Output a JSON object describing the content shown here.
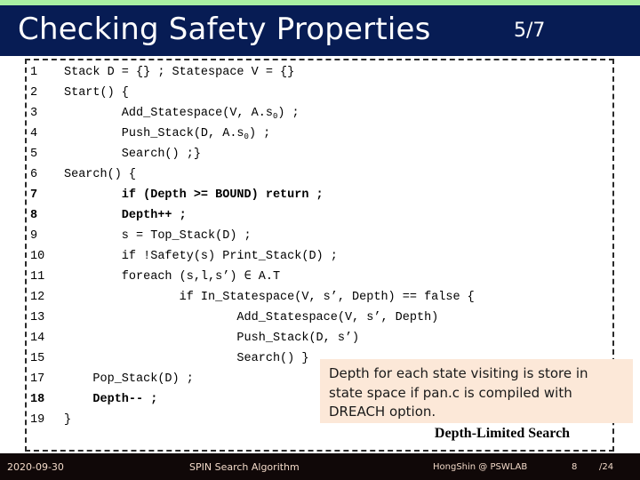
{
  "header": {
    "title": "Checking Safety Properties",
    "counter": "5/7",
    "band_color": "#071c54",
    "accent_color": "#a9f0a2"
  },
  "code": {
    "lines": [
      {
        "num": "1",
        "text": "Stack D = {} ; Statespace V = {}",
        "indent": 0,
        "bold": false
      },
      {
        "num": "2",
        "text": "Start() {",
        "indent": 0,
        "bold": false
      },
      {
        "num": "3",
        "text": "Add_Statespace(V, A.s₀) ;",
        "indent": 4,
        "bold": false
      },
      {
        "num": "4",
        "text": "Push_Stack(D, A.s₀) ;",
        "indent": 4,
        "bold": false
      },
      {
        "num": "5",
        "text": "Search() ;}",
        "indent": 4,
        "bold": false
      },
      {
        "num": "6",
        "text": "Search() {",
        "indent": 0,
        "bold": false
      },
      {
        "num": "7",
        "text": "if (Depth >= BOUND) return ;",
        "indent": 4,
        "bold": true
      },
      {
        "num": "8",
        "text": "Depth++ ;",
        "indent": 4,
        "bold": true
      },
      {
        "num": "9",
        "text": "s = Top_Stack(D) ;",
        "indent": 4,
        "bold": false
      },
      {
        "num": "10",
        "text": "if !Safety(s) Print_Stack(D) ;",
        "indent": 4,
        "bold": false
      },
      {
        "num": "11",
        "text": "foreach (s,l,s’) ∈ A.T",
        "indent": 4,
        "bold": false
      },
      {
        "num": "12",
        "text": "if In_Statespace(V, s’, Depth) == false {",
        "indent": 8,
        "bold": false
      },
      {
        "num": "13",
        "text": "Add_Statespace(V, s’, Depth)",
        "indent": 12,
        "bold": false
      },
      {
        "num": "14",
        "text": "Push_Stack(D, s’)",
        "indent": 12,
        "bold": false
      },
      {
        "num": "15",
        "text": "Search() }",
        "indent": 12,
        "bold": false
      },
      {
        "num": "17",
        "text": "Pop_Stack(D) ;",
        "indent": 2,
        "bold": false
      },
      {
        "num": "18",
        "text": "Depth-- ;",
        "indent": 2,
        "bold": true
      },
      {
        "num": "19",
        "text": "}",
        "indent": 0,
        "bold": false
      }
    ]
  },
  "callout": {
    "text": "Depth for each state visiting is store in state space if pan.c is compiled with DREACH option.",
    "background": "#fce8d8"
  },
  "caption": {
    "text": "Depth-Limited Search"
  },
  "footer": {
    "date": "2020-09-30",
    "center": "SPIN Search Algorithm",
    "author": "HongShin @ PSWLAB",
    "page_number": "8",
    "page_total": "/24",
    "background": "#100808",
    "text_color": "#f2d9c8"
  }
}
